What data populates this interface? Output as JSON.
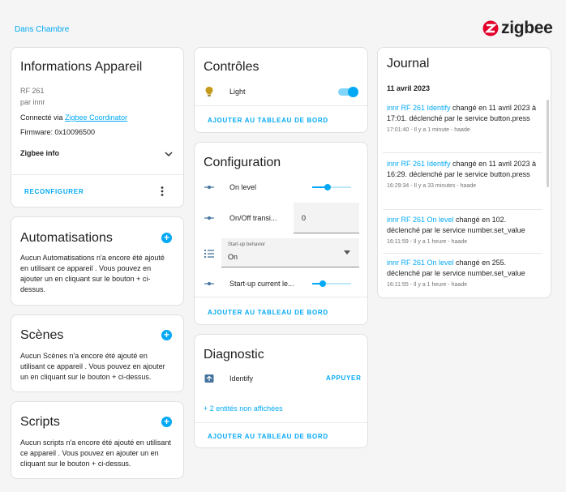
{
  "breadcrumb": "Dans Chambre",
  "brand": {
    "word": "zigbee",
    "color": "#e4002b"
  },
  "info": {
    "title": "Informations Appareil",
    "model": "RF 261",
    "maker": "par innr",
    "connected_prefix": "Connecté via ",
    "connected_link": "Zigbee Coordinator",
    "firmware": "Firmware: 0x10096500",
    "zigbee_info": "Zigbee info",
    "reconfigure": "RECONFIGURER"
  },
  "automations": {
    "title": "Automatisations",
    "text": "Aucun Automatisations n'a encore été ajouté en utilisant ce appareil . Vous pouvez en ajouter un en cliquant sur le bouton + ci-dessus."
  },
  "scenes": {
    "title": "Scènes",
    "text": "Aucun Scènes n'a encore été ajouté en utilisant ce appareil . Vous pouvez en ajouter un en cliquant sur le bouton + ci-dessus."
  },
  "scripts": {
    "title": "Scripts",
    "text": "Aucun scripts n'a encore été ajouté en utilisant ce appareil . Vous pouvez en ajouter un en cliquant sur le bouton + ci-dessus."
  },
  "controls": {
    "title": "Contrôles",
    "light_label": "Light",
    "light_on": true,
    "add_dashboard": "AJOUTER AU TABLEAU DE BORD"
  },
  "configuration": {
    "title": "Configuration",
    "on_level_label": "On level",
    "on_level_value": 0.4,
    "onoff_label": "On/Off transi...",
    "onoff_value": "0",
    "startup_behavior_label": "Start-up behavior",
    "startup_behavior_value": "On",
    "startup_level_label": "Start-up current le...",
    "startup_level_value": 0.27,
    "add_dashboard": "AJOUTER AU TABLEAU DE BORD"
  },
  "diagnostic": {
    "title": "Diagnostic",
    "identify_label": "Identify",
    "identify_button": "APPUYER",
    "hidden_entities": "+ 2 entités non affichées",
    "add_dashboard": "AJOUTER AU TABLEAU DE BORD"
  },
  "journal": {
    "title": "Journal",
    "date": "11 avril 2023",
    "entries": [
      {
        "link": "innr RF 261 Identify",
        "text": " changé en 11 avril 2023 à 17:01. déclenché par le service button.press",
        "meta": "17:01:40 - Il y a 1 minute - haade"
      },
      {
        "link": "innr RF 261 Identify",
        "text": " changé en 11 avril 2023 à 16:29. déclenché par le service button.press",
        "meta": "16:29:34 - Il y a 33 minutes - haade"
      },
      {
        "link": "innr RF 261 On level",
        "text": " changé en 102. déclenché par le service number.set_value",
        "meta": "16:11:59 - Il y a 1 heure - haade"
      },
      {
        "link": "innr RF 261 On level",
        "text": " changé en 255. déclenché par le service number.set_value",
        "meta": "16:11:55 - Il y a 1 heure - haade"
      }
    ]
  }
}
